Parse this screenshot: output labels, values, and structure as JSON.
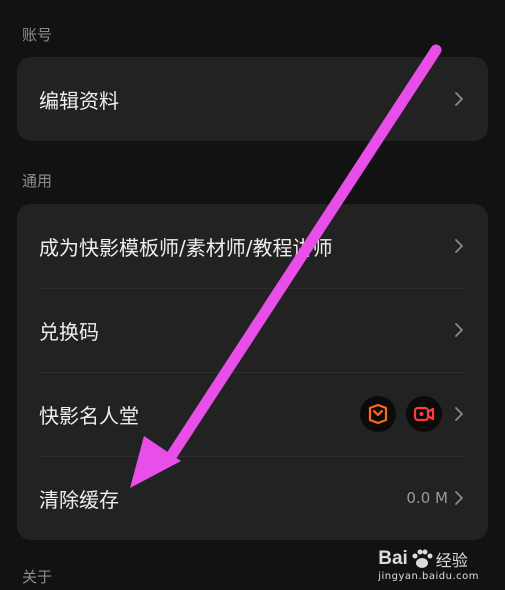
{
  "sections": {
    "account": {
      "label": "账号",
      "items": [
        {
          "label": "编辑资料"
        }
      ]
    },
    "general": {
      "label": "通用",
      "items": [
        {
          "label": "成为快影模板师/素材师/教程讲师"
        },
        {
          "label": "兑换码"
        },
        {
          "label": "快影名人堂",
          "badges": [
            "kuaiying-logo-icon",
            "video-camera-icon"
          ]
        },
        {
          "label": "清除缓存",
          "value": "0.0 M"
        }
      ]
    },
    "about": {
      "label": "关于"
    }
  },
  "annotation": {
    "arrow_color": "#e84fe8"
  },
  "watermark": {
    "brand": "Bai",
    "brand_suffix": "经验",
    "url": "jingyan.baidu.com"
  },
  "colors": {
    "background": "#121212",
    "card": "#222222",
    "accent_orange": "#ff6a1a",
    "accent_red": "#ff3b3b"
  }
}
